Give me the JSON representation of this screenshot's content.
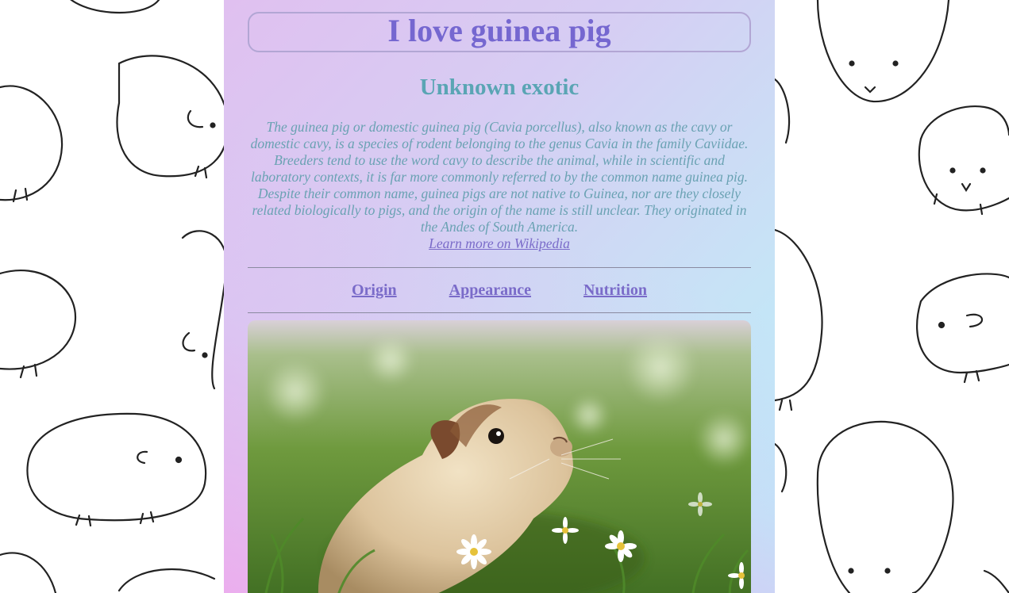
{
  "header": {
    "title": "I love guinea pig"
  },
  "main": {
    "subtitle": "Unknown exotic",
    "description": "The guinea pig or domestic guinea pig (Cavia porcellus), also known as the cavy or domestic cavy, is a species of rodent belonging to the genus Cavia in the family Caviidae. Breeders tend to use the word cavy to describe the animal, while in scientific and laboratory contexts, it is far more commonly referred to by the common name guinea pig. Despite their common name, guinea pigs are not native to Guinea, nor are they closely related biologically to pigs, and the origin of the name is still unclear. They originated in the Andes of South America.",
    "wiki_link": "Learn more on Wikipedia"
  },
  "nav": {
    "items": [
      {
        "label": "Origin"
      },
      {
        "label": "Appearance"
      },
      {
        "label": "Nutrition"
      }
    ]
  },
  "photo": {
    "icon": "guinea-pig-photo"
  },
  "colors": {
    "title": "#7567d0",
    "subtitle": "#5aa5b4",
    "description": "#6aa2b3",
    "link": "#7a6bc9",
    "gradient_start": "#f3a6ee",
    "gradient_end": "#b6f0fb"
  }
}
